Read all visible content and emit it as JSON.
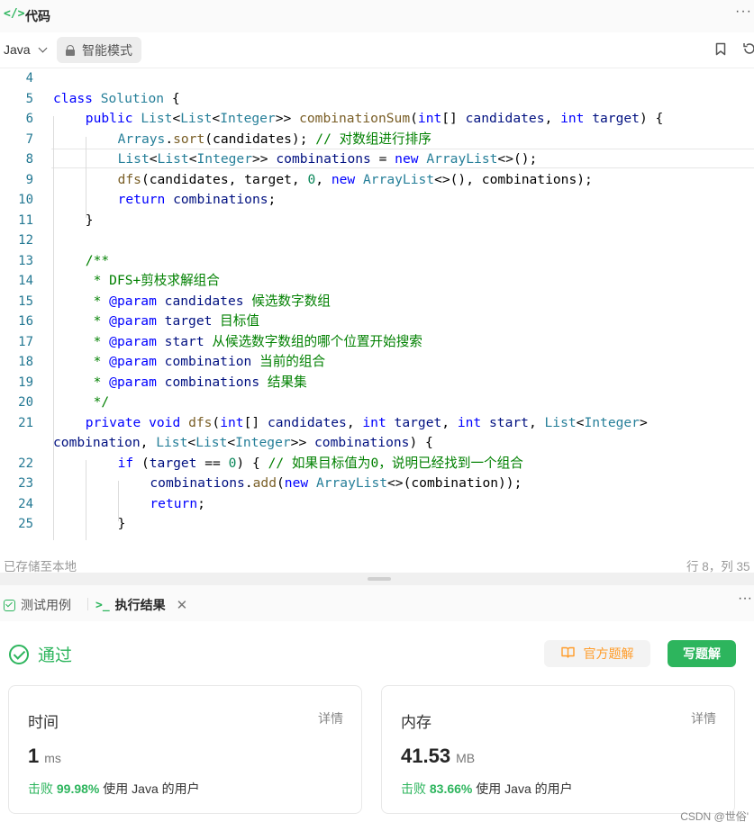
{
  "header": {
    "icon": "</>",
    "title": "代码",
    "more": "···"
  },
  "toolbar": {
    "language": "Java",
    "smart_mode": "智能模式"
  },
  "code": {
    "active_line": "8",
    "lines": [
      {
        "no": "4"
      },
      {
        "no": "5"
      },
      {
        "no": "6"
      },
      {
        "no": "7"
      },
      {
        "no": "8"
      },
      {
        "no": "9"
      },
      {
        "no": "10"
      },
      {
        "no": "11"
      },
      {
        "no": "12"
      },
      {
        "no": "13"
      },
      {
        "no": "14"
      },
      {
        "no": "15"
      },
      {
        "no": "16"
      },
      {
        "no": "17"
      },
      {
        "no": "18"
      },
      {
        "no": "19"
      },
      {
        "no": "20"
      },
      {
        "no": "21"
      },
      {
        "no": ""
      },
      {
        "no": "22"
      },
      {
        "no": "23"
      },
      {
        "no": "24"
      },
      {
        "no": "25"
      }
    ],
    "tokens": {
      "l5": [
        "class",
        " ",
        "Solution",
        " {"
      ],
      "l6": [
        "public",
        " ",
        "List",
        "<",
        "List",
        "<",
        "Integer",
        ">> ",
        "combinationSum",
        "(",
        "int",
        "[] ",
        "candidates",
        ", ",
        "int",
        " ",
        "target",
        ") {"
      ],
      "l7": [
        "Arrays",
        ".",
        "sort",
        "(candidates); ",
        "// 对数组进行排序"
      ],
      "l8": [
        "List",
        "<",
        "List",
        "<",
        "Integer",
        ">> ",
        "combinations",
        " = ",
        "new",
        " ",
        "ArrayList",
        "<>();"
      ],
      "l9": [
        "dfs",
        "(candidates, target, ",
        "0",
        ", ",
        "new",
        " ",
        "ArrayList",
        "<>(), combinations);"
      ],
      "l10": [
        "return",
        " ",
        "combinations",
        ";"
      ],
      "l11": [
        "}"
      ],
      "l13": [
        "/**"
      ],
      "l14": [
        " * DFS+剪枝求解组合"
      ],
      "l15": [
        " * ",
        "@param",
        " ",
        "candidates",
        " 候选数字数组"
      ],
      "l16": [
        " * ",
        "@param",
        " ",
        "target",
        " 目标值"
      ],
      "l17": [
        " * ",
        "@param",
        " ",
        "start",
        " 从候选数字数组的哪个位置开始搜索"
      ],
      "l18": [
        " * ",
        "@param",
        " ",
        "combination",
        " 当前的组合"
      ],
      "l19": [
        " * ",
        "@param",
        " ",
        "combinations",
        " 结果集"
      ],
      "l20": [
        " */"
      ],
      "l21": [
        "private",
        " ",
        "void",
        " ",
        "dfs",
        "(",
        "int",
        "[] ",
        "candidates",
        ", ",
        "int",
        " ",
        "target",
        ", ",
        "int",
        " ",
        "start",
        ", ",
        "List",
        "<",
        "Integer",
        ">"
      ],
      "l21b": [
        "combination",
        ", ",
        "List",
        "<",
        "List",
        "<",
        "Integer",
        ">> ",
        "combinations",
        ") {"
      ],
      "l22": [
        "if",
        " (",
        "target",
        " == ",
        "0",
        ") { ",
        "// 如果目标值为0，说明已经找到一个组合"
      ],
      "l23": [
        "combinations",
        ".",
        "add",
        "(",
        "new",
        " ",
        "ArrayList",
        "<>(combination));"
      ],
      "l24": [
        "return",
        ";"
      ],
      "l25": [
        "}"
      ]
    }
  },
  "status": {
    "saved": "已存储至本地",
    "cursor": "行 8，列 35"
  },
  "result": {
    "tab_test": "测试用例",
    "tab_result": "执行结果",
    "status": "通过",
    "official_solution": "官方题解",
    "write_solution": "写题解",
    "time": {
      "label": "时间",
      "detail": "详情",
      "value": "1",
      "unit": "ms",
      "beat_prefix": "击败",
      "beat_pct": "99.98%",
      "beat_suffix": "使用 Java 的用户"
    },
    "memory": {
      "label": "内存",
      "detail": "详情",
      "value": "41.53",
      "unit": "MB",
      "beat_prefix": "击败",
      "beat_pct": "83.66%",
      "beat_suffix": "使用 Java 的用户"
    }
  },
  "watermark": "CSDN @世俗'",
  "colors": {
    "accent_green": "#2db55d",
    "orange": "#ff9c2a",
    "keyword": "#0000ff",
    "type": "#267f99",
    "comment": "#008000"
  }
}
